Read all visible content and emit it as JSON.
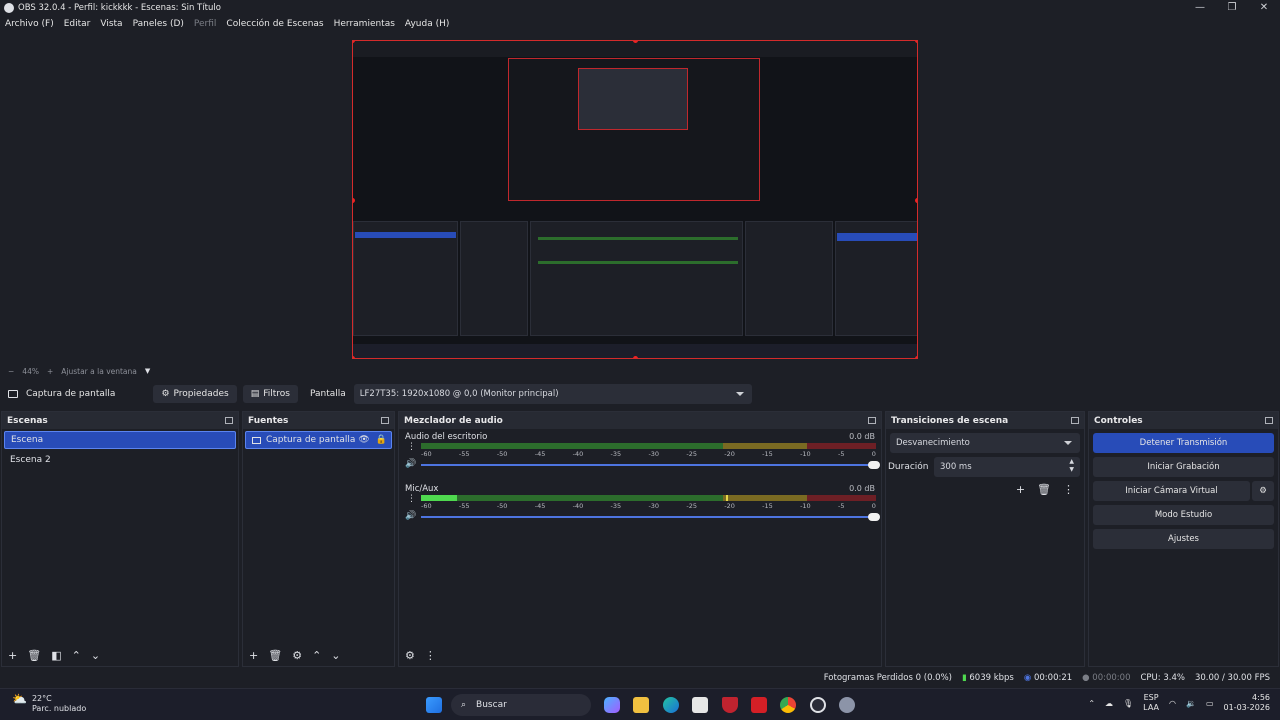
{
  "window": {
    "title": "OBS 32.0.4 - Perfil: kickkkk - Escenas: Sin Título",
    "minimize": "—",
    "maximize": "❐",
    "close": "✕"
  },
  "menu": {
    "items": [
      "Archivo (F)",
      "Editar",
      "Vista",
      "Paneles (D)",
      "Perfil",
      "Colección de Escenas",
      "Herramientas",
      "Ayuda (H)"
    ]
  },
  "zoom": {
    "minus": "−",
    "level": "44%",
    "plus": "+",
    "fit": "Ajustar a la ventana"
  },
  "source_bar": {
    "source_name": "Captura de pantalla",
    "properties": "Propiedades",
    "filters": "Filtros",
    "display_label": "Pantalla",
    "display_value": "LF27T35: 1920x1080 @ 0,0 (Monitor principal)"
  },
  "scenes": {
    "title": "Escenas",
    "items": [
      "Escena",
      "Escena 2"
    ]
  },
  "sources": {
    "title": "Fuentes",
    "items": [
      "Captura de pantalla"
    ]
  },
  "mixer": {
    "title": "Mezclador de audio",
    "ticks": [
      "-60",
      "-55",
      "-50",
      "-45",
      "-40",
      "-35",
      "-30",
      "-25",
      "-20",
      "-15",
      "-10",
      "-5",
      "0"
    ],
    "channels": [
      {
        "name": "Audio del escritorio",
        "db": "0.0 dB",
        "level": 0.0,
        "peak": 0.0
      },
      {
        "name": "Mic/Aux",
        "db": "0.0 dB",
        "level": 0.08,
        "peak": 0.67
      }
    ]
  },
  "transitions": {
    "title": "Transiciones de escena",
    "selected": "Desvanecimiento",
    "duration_label": "Duración",
    "duration_value": "300 ms"
  },
  "controls": {
    "title": "Controles",
    "stop_stream": "Detener Transmisión",
    "start_recording": "Iniciar Grabación",
    "start_virtual_cam": "Iniciar Cámara Virtual",
    "studio_mode": "Modo Estudio",
    "settings": "Ajustes"
  },
  "status": {
    "dropped_frames": "Fotogramas Perdidos 0 (0.0%)",
    "bitrate": "6039 kbps",
    "stream_time": "00:00:21",
    "rec_time": "00:00:00",
    "cpu": "CPU: 3.4%",
    "fps": "30.00 / 30.00 FPS"
  },
  "taskbar": {
    "weather_temp": "22°C",
    "weather_desc": "Parc. nublado",
    "search": "Buscar",
    "lang": "ESP",
    "lang2": "LAA",
    "time": "4:56",
    "date": "01-03-2026"
  },
  "colors": {
    "accent": "#284cb8",
    "preview_border": "#d42b2b",
    "meter_green": "#2c6d2c",
    "meter_active": "#4fd94f"
  }
}
